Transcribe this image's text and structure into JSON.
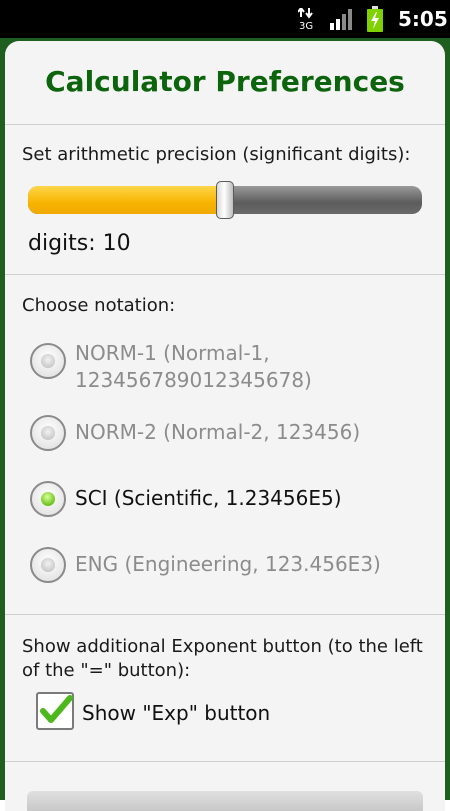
{
  "status_bar": {
    "network_type": "3G",
    "time": "5:05",
    "icons": [
      "data-activity-icon",
      "signal-icon",
      "battery-charging-icon"
    ]
  },
  "dialog": {
    "title": "Calculator Preferences",
    "precision": {
      "label": "Set arithmetic precision (significant digits):",
      "digits_text": "digits: 10",
      "slider_fraction": 0.5
    },
    "notation": {
      "label": "Choose notation:",
      "options": [
        {
          "lines": [
            "NORM-1 (Normal-1,",
            "123456789012345678)"
          ],
          "selected": false
        },
        {
          "lines": [
            "NORM-2 (Normal-2, 123456)"
          ],
          "selected": false
        },
        {
          "lines": [
            "SCI (Scientific, 1.23456E5)"
          ],
          "selected": true
        },
        {
          "lines": [
            "ENG (Engineering, 123.456E3)"
          ],
          "selected": false
        }
      ]
    },
    "exponent": {
      "label_lines": [
        "Show additional Exponent button (to the left",
        "of the \"=\" button):"
      ],
      "checkbox_label": "Show \"Exp\" button",
      "checked": true
    }
  },
  "colors": {
    "title": "#0c640c",
    "slider_fill": "#f7b400",
    "frame": "#1e5e1e",
    "radio_selected": "#6cc21c"
  }
}
